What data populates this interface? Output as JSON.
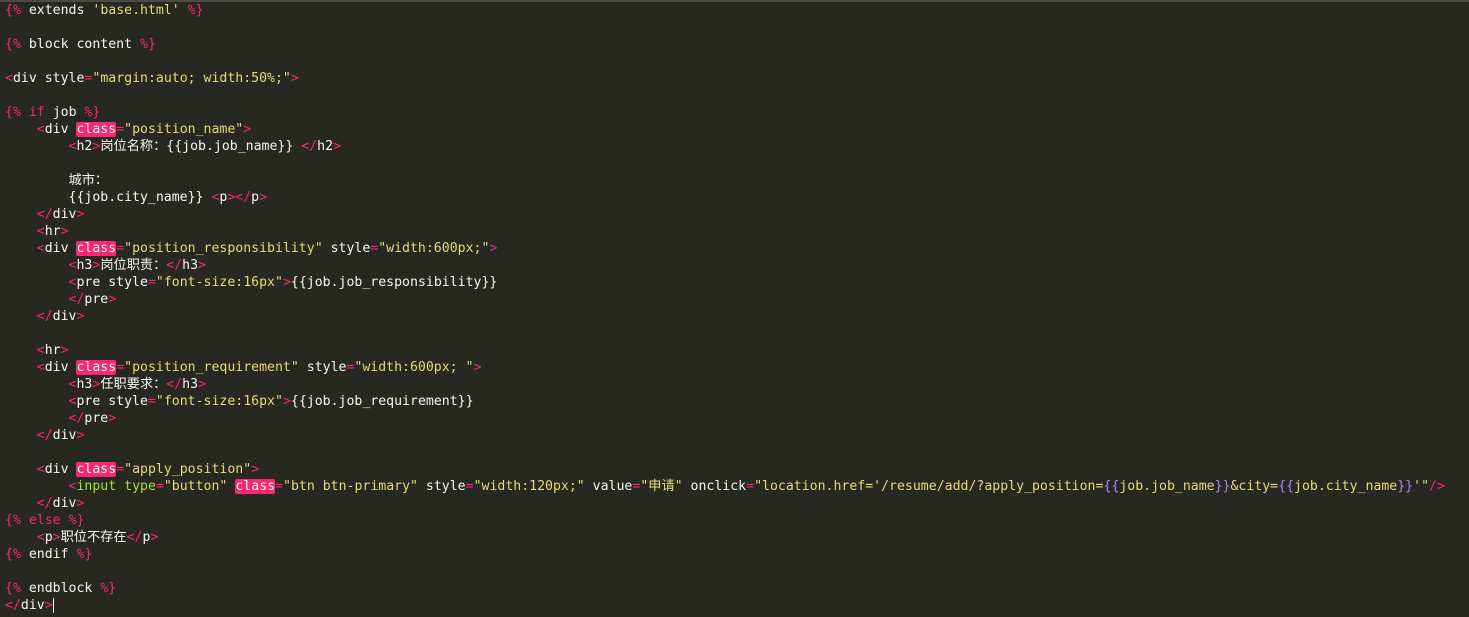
{
  "editor": {
    "lines": [
      [
        [
          "t-tag",
          "{"
        ],
        [
          "t-kw",
          "%"
        ],
        [
          "t-text",
          " extends "
        ],
        [
          "t-str",
          "'base.html'"
        ],
        [
          "t-text",
          " "
        ],
        [
          "t-kw",
          "%"
        ],
        [
          "t-tag",
          "}"
        ]
      ],
      [],
      [
        [
          "t-tag",
          "{"
        ],
        [
          "t-kw",
          "%"
        ],
        [
          "t-text",
          " block content "
        ],
        [
          "t-kw",
          "%"
        ],
        [
          "t-tag",
          "}"
        ]
      ],
      [],
      [
        [
          "t-tag",
          "<"
        ],
        [
          "t-text",
          "div style"
        ],
        [
          "t-tag",
          "="
        ],
        [
          "t-str",
          "\"margin:auto; width:50%;\""
        ],
        [
          "t-tag",
          ">"
        ]
      ],
      [],
      [
        [
          "t-tag",
          "{"
        ],
        [
          "t-kw",
          "%"
        ],
        [
          "t-text",
          " "
        ],
        [
          "t-kw",
          "if"
        ],
        [
          "t-text",
          " job "
        ],
        [
          "t-kw",
          "%"
        ],
        [
          "t-tag",
          "}"
        ]
      ],
      [
        [
          "t-text",
          "    "
        ],
        [
          "t-tag",
          "<"
        ],
        [
          "t-text",
          "div "
        ],
        [
          "t-hl",
          "class"
        ],
        [
          "t-tag",
          "="
        ],
        [
          "t-str",
          "\"position_name\""
        ],
        [
          "t-tag",
          ">"
        ]
      ],
      [
        [
          "t-text",
          "        "
        ],
        [
          "t-tag",
          "<"
        ],
        [
          "t-text",
          "h2"
        ],
        [
          "t-tag",
          ">"
        ],
        [
          "t-text",
          "岗位名称：{{job.job_name}} "
        ],
        [
          "t-tag",
          "</"
        ],
        [
          "t-text",
          "h2"
        ],
        [
          "t-tag",
          ">"
        ]
      ],
      [],
      [
        [
          "t-text",
          "        城市："
        ]
      ],
      [
        [
          "t-text",
          "        {{job.city_name}} "
        ],
        [
          "t-tag",
          "<"
        ],
        [
          "t-text",
          "p"
        ],
        [
          "t-tag",
          "></"
        ],
        [
          "t-text",
          "p"
        ],
        [
          "t-tag",
          ">"
        ]
      ],
      [
        [
          "t-text",
          "    "
        ],
        [
          "t-tag",
          "</"
        ],
        [
          "t-text",
          "div"
        ],
        [
          "t-tag",
          ">"
        ]
      ],
      [
        [
          "t-text",
          "    "
        ],
        [
          "t-tag",
          "<"
        ],
        [
          "t-text",
          "hr"
        ],
        [
          "t-tag",
          ">"
        ]
      ],
      [
        [
          "t-text",
          "    "
        ],
        [
          "t-tag",
          "<"
        ],
        [
          "t-text",
          "div "
        ],
        [
          "t-hl",
          "class"
        ],
        [
          "t-tag",
          "="
        ],
        [
          "t-str",
          "\"position_responsibility\""
        ],
        [
          "t-text",
          " style"
        ],
        [
          "t-tag",
          "="
        ],
        [
          "t-str",
          "\"width:600px;\""
        ],
        [
          "t-tag",
          ">"
        ]
      ],
      [
        [
          "t-text",
          "        "
        ],
        [
          "t-tag",
          "<"
        ],
        [
          "t-text",
          "h3"
        ],
        [
          "t-tag",
          ">"
        ],
        [
          "t-text",
          "岗位职责："
        ],
        [
          "t-tag",
          "</"
        ],
        [
          "t-text",
          "h3"
        ],
        [
          "t-tag",
          ">"
        ]
      ],
      [
        [
          "t-text",
          "        "
        ],
        [
          "t-tag",
          "<"
        ],
        [
          "t-text",
          "pre style"
        ],
        [
          "t-tag",
          "="
        ],
        [
          "t-str",
          "\"font-size:16px\""
        ],
        [
          "t-tag",
          ">"
        ],
        [
          "t-text",
          "{{job.job_responsibility}}"
        ]
      ],
      [
        [
          "t-text",
          "        "
        ],
        [
          "t-tag",
          "</"
        ],
        [
          "t-text",
          "pre"
        ],
        [
          "t-tag",
          ">"
        ]
      ],
      [
        [
          "t-text",
          "    "
        ],
        [
          "t-tag",
          "</"
        ],
        [
          "t-text",
          "div"
        ],
        [
          "t-tag",
          ">"
        ]
      ],
      [],
      [
        [
          "t-text",
          "    "
        ],
        [
          "t-tag",
          "<"
        ],
        [
          "t-text",
          "hr"
        ],
        [
          "t-tag",
          ">"
        ]
      ],
      [
        [
          "t-text",
          "    "
        ],
        [
          "t-tag",
          "<"
        ],
        [
          "t-text",
          "div "
        ],
        [
          "t-hl",
          "class"
        ],
        [
          "t-tag",
          "="
        ],
        [
          "t-str",
          "\"position_requirement\""
        ],
        [
          "t-text",
          " style"
        ],
        [
          "t-tag",
          "="
        ],
        [
          "t-str",
          "\"width:600px; \""
        ],
        [
          "t-tag",
          ">"
        ]
      ],
      [
        [
          "t-text",
          "        "
        ],
        [
          "t-tag",
          "<"
        ],
        [
          "t-text",
          "h3"
        ],
        [
          "t-tag",
          ">"
        ],
        [
          "t-text",
          "任职要求："
        ],
        [
          "t-tag",
          "</"
        ],
        [
          "t-text",
          "h3"
        ],
        [
          "t-tag",
          ">"
        ]
      ],
      [
        [
          "t-text",
          "        "
        ],
        [
          "t-tag",
          "<"
        ],
        [
          "t-text",
          "pre style"
        ],
        [
          "t-tag",
          "="
        ],
        [
          "t-str",
          "\"font-size:16px\""
        ],
        [
          "t-tag",
          ">"
        ],
        [
          "t-text",
          "{{job.job_requirement}}"
        ]
      ],
      [
        [
          "t-text",
          "        "
        ],
        [
          "t-tag",
          "</"
        ],
        [
          "t-text",
          "pre"
        ],
        [
          "t-tag",
          ">"
        ]
      ],
      [
        [
          "t-text",
          "    "
        ],
        [
          "t-tag",
          "</"
        ],
        [
          "t-text",
          "div"
        ],
        [
          "t-tag",
          ">"
        ]
      ],
      [],
      [
        [
          "t-text",
          "    "
        ],
        [
          "t-tag",
          "<"
        ],
        [
          "t-text",
          "div "
        ],
        [
          "t-hl",
          "class"
        ],
        [
          "t-tag",
          "="
        ],
        [
          "t-str",
          "\"apply_position\""
        ],
        [
          "t-tag",
          ">"
        ]
      ],
      [
        [
          "t-text",
          "        "
        ],
        [
          "t-tag",
          "<"
        ],
        [
          "t-attr",
          "input"
        ],
        [
          "t-text",
          " "
        ],
        [
          "t-attr",
          "type"
        ],
        [
          "t-tag",
          "="
        ],
        [
          "t-str",
          "\"button\""
        ],
        [
          "t-text",
          " "
        ],
        [
          "t-hl",
          "class"
        ],
        [
          "t-tag",
          "="
        ],
        [
          "t-str",
          "\"btn btn-primary\""
        ],
        [
          "t-text",
          " style"
        ],
        [
          "t-tag",
          "="
        ],
        [
          "t-str",
          "\"width:120px;\""
        ],
        [
          "t-text",
          " value"
        ],
        [
          "t-tag",
          "="
        ],
        [
          "t-str",
          "\"申请\""
        ],
        [
          "t-text",
          " onclick"
        ],
        [
          "t-tag",
          "="
        ],
        [
          "t-str",
          "\"location.href='/resume/add/?apply_position="
        ],
        [
          "t-tmpl",
          "{{"
        ],
        [
          "t-str",
          "job.job_name"
        ],
        [
          "t-tmpl",
          "}}"
        ],
        [
          "t-str",
          "&city="
        ],
        [
          "t-tmpl",
          "{{"
        ],
        [
          "t-str",
          "job.city_name"
        ],
        [
          "t-tmpl",
          "}}"
        ],
        [
          "t-str",
          "'\""
        ],
        [
          "t-tag",
          "/>"
        ]
      ],
      [
        [
          "t-text",
          "    "
        ],
        [
          "t-tag",
          "</"
        ],
        [
          "t-text",
          "div"
        ],
        [
          "t-tag",
          ">"
        ]
      ],
      [
        [
          "t-tag",
          "{"
        ],
        [
          "t-kw",
          "%"
        ],
        [
          "t-text",
          " "
        ],
        [
          "t-kw",
          "else"
        ],
        [
          "t-text",
          " "
        ],
        [
          "t-kw",
          "%"
        ],
        [
          "t-tag",
          "}"
        ]
      ],
      [
        [
          "t-text",
          "    "
        ],
        [
          "t-tag",
          "<"
        ],
        [
          "t-text",
          "p"
        ],
        [
          "t-tag",
          ">"
        ],
        [
          "t-text",
          "职位不存在"
        ],
        [
          "t-tag",
          "</"
        ],
        [
          "t-text",
          "p"
        ],
        [
          "t-tag",
          ">"
        ]
      ],
      [
        [
          "t-tag",
          "{"
        ],
        [
          "t-kw",
          "%"
        ],
        [
          "t-text",
          " endif "
        ],
        [
          "t-kw",
          "%"
        ],
        [
          "t-tag",
          "}"
        ]
      ],
      [],
      [
        [
          "t-tag",
          "{"
        ],
        [
          "t-kw",
          "%"
        ],
        [
          "t-text",
          " endblock "
        ],
        [
          "t-kw",
          "%"
        ],
        [
          "t-tag",
          "}"
        ]
      ],
      [
        [
          "t-tag",
          "</"
        ],
        [
          "t-text",
          "div"
        ],
        [
          "t-tag",
          ">"
        ],
        [
          "cursor",
          ""
        ]
      ]
    ]
  }
}
